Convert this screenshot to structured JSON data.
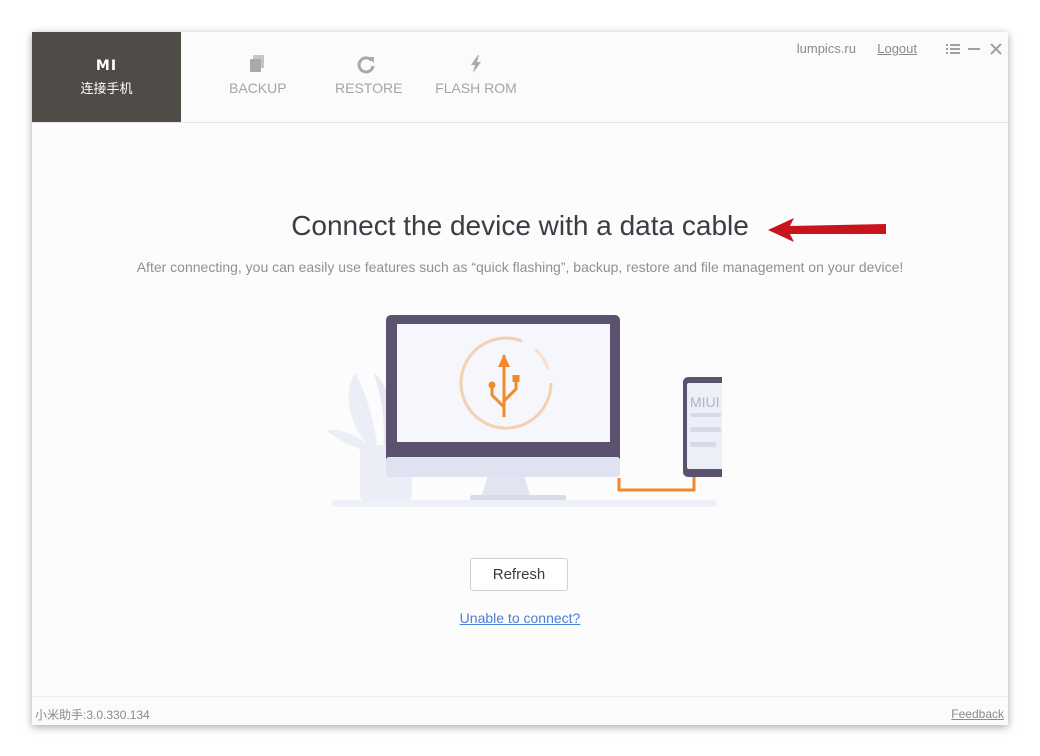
{
  "header": {
    "device_tab": {
      "logo": "MI",
      "label": "连接手机"
    },
    "tabs": [
      {
        "label": "BACKUP",
        "icon": "backup-icon"
      },
      {
        "label": "RESTORE",
        "icon": "restore-icon"
      },
      {
        "label": "FLASH ROM",
        "icon": "flash-icon"
      }
    ],
    "user": "lumpics.ru",
    "logout": "Logout"
  },
  "main": {
    "title": "Connect the device with a data cable",
    "subtitle": "After connecting, you can easily use features such as “quick flashing”, backup, restore and file management on your device!",
    "phone_label": "MIUI",
    "refresh_label": "Refresh",
    "unable_link": "Unable to connect?"
  },
  "footer": {
    "version": "小米助手:3.0.330.134",
    "feedback": "Feedback"
  },
  "colors": {
    "accent_orange": "#f08a2c",
    "device_tab_bg": "#4f4c48",
    "link_blue": "#4a7fd6",
    "arrow_red": "#c8141c"
  }
}
